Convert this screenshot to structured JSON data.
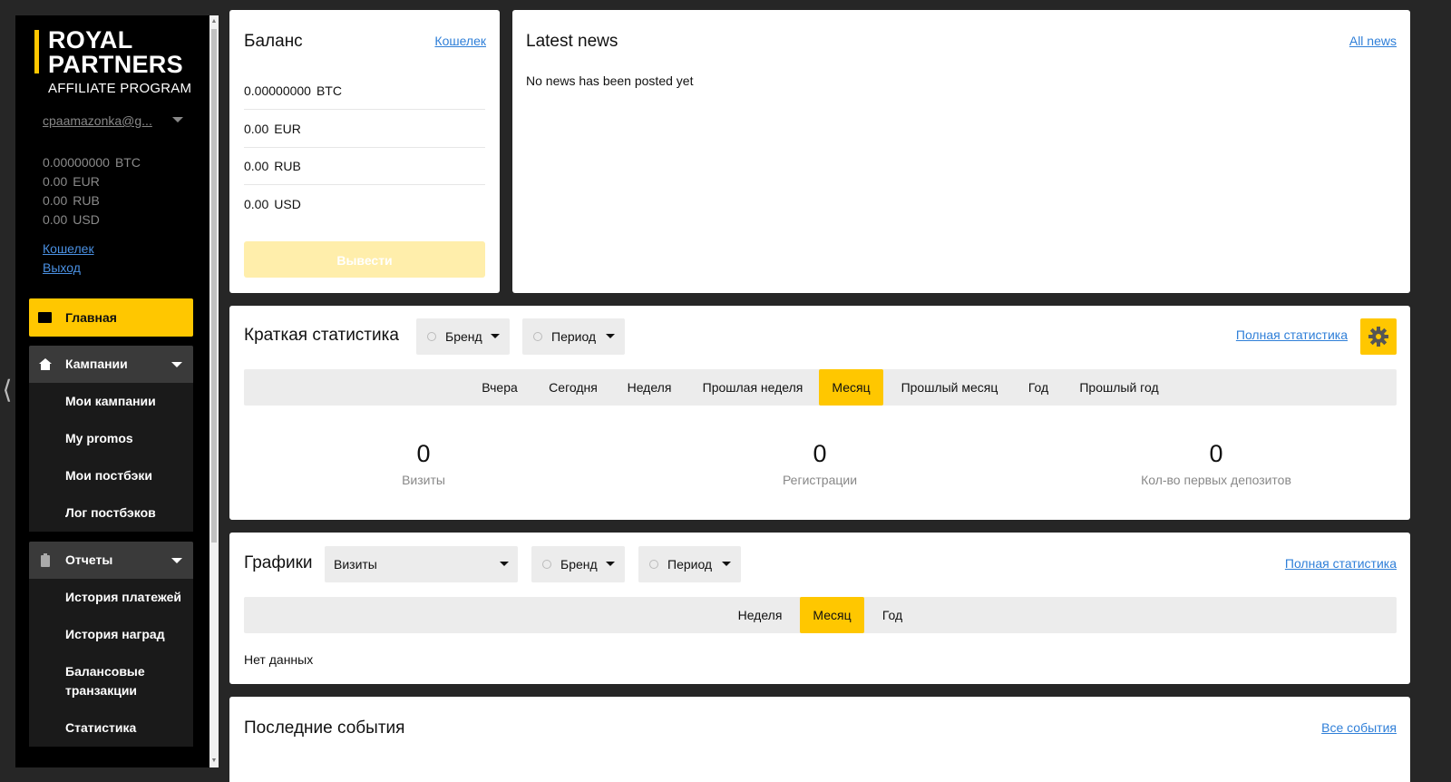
{
  "sidebar": {
    "logo": {
      "line1": "ROYAL",
      "line2": "PARTNERS",
      "line3": "AFFILIATE PROGRAM"
    },
    "user_email": "cpaamazonka@g...",
    "balances": [
      {
        "value": "0.00000000",
        "currency": "BTC"
      },
      {
        "value": "0.00",
        "currency": "EUR"
      },
      {
        "value": "0.00",
        "currency": "RUB"
      },
      {
        "value": "0.00",
        "currency": "USD"
      }
    ],
    "links": {
      "wallet": "Кошелек",
      "logout": "Выход"
    },
    "menu": {
      "main": "Главная",
      "campaigns": {
        "label": "Кампании",
        "items": [
          "Мои кампании",
          "My promos",
          "Мои постбэки",
          "Лог постбэков"
        ]
      },
      "reports": {
        "label": "Отчеты",
        "items": [
          "История платежей",
          "История наград",
          "Балансовые транзакции",
          "Статистика"
        ]
      }
    },
    "accent_color": "#ffc700"
  },
  "balance_card": {
    "title": "Баланс",
    "link": "Кошелек",
    "rows": [
      {
        "value": "0.00000000",
        "currency": "BTC"
      },
      {
        "value": "0.00",
        "currency": "EUR"
      },
      {
        "value": "0.00",
        "currency": "RUB"
      },
      {
        "value": "0.00",
        "currency": "USD"
      }
    ],
    "withdraw_label": "Вывести"
  },
  "news_card": {
    "title": "Latest news",
    "link": "All news",
    "empty_text": "No news has been posted yet"
  },
  "stats_card": {
    "title": "Краткая статистика",
    "brand_label": "Бренд",
    "period_label": "Период",
    "link": "Полная статистика",
    "tabs": [
      "Вчера",
      "Сегодня",
      "Неделя",
      "Прошлая неделя",
      "Месяц",
      "Прошлый месяц",
      "Год",
      "Прошлый год"
    ],
    "active_tab": "Месяц",
    "stats": [
      {
        "value": "0",
        "label": "Визиты"
      },
      {
        "value": "0",
        "label": "Регистрации"
      },
      {
        "value": "0",
        "label": "Кол-во первых депозитов"
      }
    ]
  },
  "charts_card": {
    "title": "Графики",
    "metric_label": "Визиты",
    "brand_label": "Бренд",
    "period_label": "Период",
    "link": "Полная статистика",
    "tabs": [
      "Неделя",
      "Месяц",
      "Год"
    ],
    "active_tab": "Месяц",
    "empty_text": "Нет данных"
  },
  "events_card": {
    "title": "Последние события",
    "link": "Все события"
  }
}
